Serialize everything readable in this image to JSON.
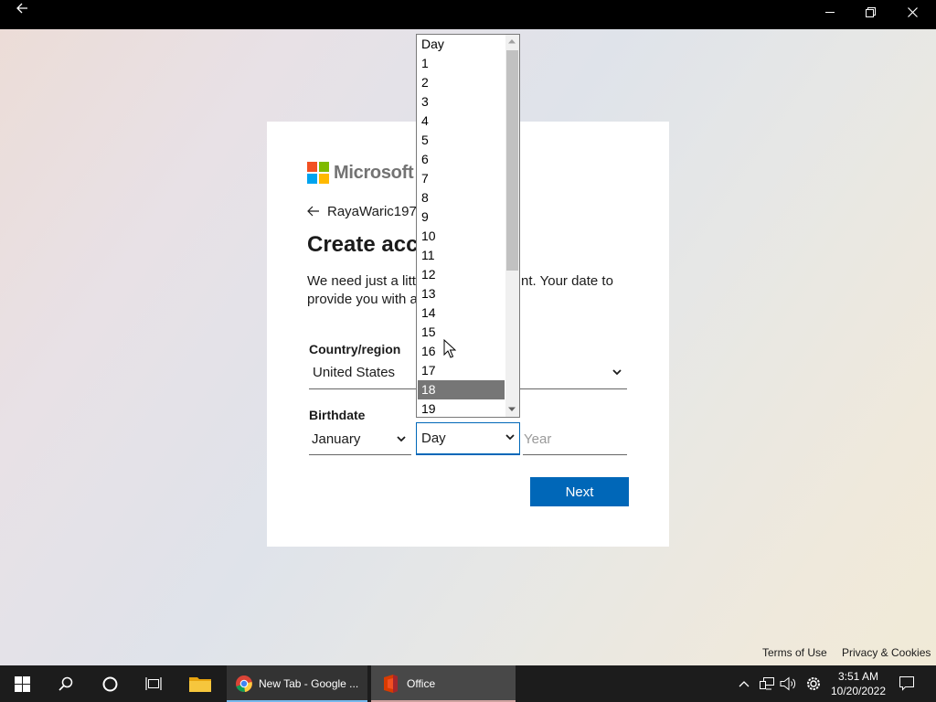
{
  "window": {
    "back_icon": "back-arrow-icon",
    "controls": [
      "minimize-icon",
      "restore-icon",
      "close-icon"
    ]
  },
  "card": {
    "brand": "Microsoft",
    "identity": "RayaWaric197",
    "title": "Create acco",
    "description": "We need just a litt et up your account. Your date to provide you with age-appropri",
    "country_label": "Country/region",
    "country_value": "United States",
    "birthdate_label": "Birthdate",
    "month_value": "January",
    "next_label": "Next"
  },
  "birthdate": {
    "day_value": "Day",
    "year_placeholder": "Year",
    "day_options": [
      "Day",
      "1",
      "2",
      "3",
      "4",
      "5",
      "6",
      "7",
      "8",
      "9",
      "10",
      "11",
      "12",
      "13",
      "14",
      "15",
      "16",
      "17",
      "18",
      "19"
    ],
    "highlighted_option": "18"
  },
  "footer": {
    "terms": "Terms of Use",
    "privacy": "Privacy & Cookies"
  },
  "taskbar": {
    "apps": [
      {
        "label": "New Tab - Google ...",
        "icon": "chrome-icon"
      },
      {
        "label": "Office",
        "icon": "office-icon"
      }
    ],
    "time": "3:51 AM",
    "date": "10/20/2022"
  },
  "colors": {
    "accent": "#0067b8",
    "highlight": "#767676",
    "taskbar": "#1c1c1c"
  }
}
